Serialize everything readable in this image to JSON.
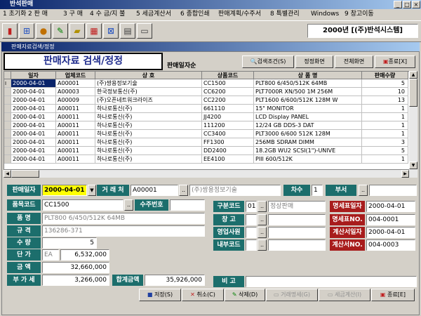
{
  "window": {
    "title": "반석판매"
  },
  "menu": [
    "1 초기화",
    "2 판 매",
    "3 구 매",
    "4 수 금/지 불",
    "5 세금계산서",
    "6 종합인쇄",
    "판매계획/수주서",
    "8 특별관리",
    "Windows",
    "9 창고이동"
  ],
  "company_label": "2000년 [(주)반석시스템]",
  "child_window": {
    "title": "판매자료검색/정정"
  },
  "header": {
    "title": "판매자료 검색/정정",
    "subtitle": "판매일자순"
  },
  "buttons": {
    "search": "검색조건(S)",
    "single": "정정화면",
    "full": "전체화면",
    "close_top": "종료[X]"
  },
  "grid": {
    "columns": [
      "일자",
      "업체코드",
      "상 호",
      "상품코드",
      "상 품 명",
      "판매수량"
    ],
    "rows": [
      [
        "2000-04-01",
        "A00001",
        "(주)쌍용정보기술",
        "CC1500",
        "PLT800 6/450/512K 64MB",
        "5"
      ],
      [
        "2000-04-01",
        "A00003",
        "한국정보통신(주)",
        "CC6200",
        "PLT7000R XN/500 1M 256M",
        "10"
      ],
      [
        "2000-04-01",
        "A00009",
        "(주)오픈네트워크라이즈",
        "CC2200",
        "PLT1600 6/600/512K 128M W",
        "13"
      ],
      [
        "2000-04-01",
        "A00011",
        "하나로통신(주)",
        "661110",
        "15\" MONITOR",
        "1"
      ],
      [
        "2000-04-01",
        "A00011",
        "하나로통신(주)",
        "JJ4200",
        "LCD Display PANEL",
        "1"
      ],
      [
        "2000-04-01",
        "A00011",
        "하나로통신(주)",
        "111200",
        "12/24 GB DDS-3 DAT",
        "1"
      ],
      [
        "2000-04-01",
        "A00011",
        "하나로통신(주)",
        "CC3400",
        "PLT3000 6/600 512K 128M",
        "1"
      ],
      [
        "2000-04-01",
        "A00011",
        "하나로통신(주)",
        "FF1300",
        "256MB SDRAM DIMM",
        "3"
      ],
      [
        "2000-04-01",
        "A00011",
        "하나로통신(주)",
        "DD2400",
        "18.2GB WU2 SCSI(1\")-UNIVE",
        "5"
      ],
      [
        "2000-04-01",
        "A00011",
        "하나로통신(주)",
        "EE4100",
        "PIII 600/512K",
        "1"
      ]
    ]
  },
  "form": {
    "sale_date_label": "판매일자",
    "sale_date": "2000-04-01",
    "customer_label": "거 래 처",
    "customer_code": "A00001",
    "customer_name": "(주)쌍용정보기술",
    "seq_label": "차수",
    "seq": "1",
    "dept_label": "부서",
    "item_code_label": "품목코드",
    "item_code": "CC1500",
    "order_label": "수주번호",
    "item_name_label": "품 명",
    "item_name": "PLT800 6/450/512K 64MB",
    "spec_label": "규 격",
    "spec": "136286-371",
    "qty_label": "수 량",
    "qty": "5",
    "price_label": "단 가",
    "unit": "EA",
    "price": "6,532,000",
    "amount_label": "금 액",
    "amount": "32,660,000",
    "vat_label": "부 가 세",
    "vat": "3,266,000",
    "total_label": "합계금액",
    "total": "35,926,000",
    "type_label": "구분코드",
    "type_code": "01",
    "type_name": "정상판매",
    "warehouse_label": "창 고",
    "sales_rep_label": "영업사원",
    "internal_label": "내부코드",
    "stmt_date_label": "명세표일자",
    "stmt_date": "2000-04-01",
    "stmt_no_label": "명세표NO.",
    "stmt_no": "004-0001",
    "tax_date_label": "계산서일자",
    "tax_date": "2000-04-01",
    "tax_no_label": "계산서NO.",
    "tax_no": "004-0003",
    "memo_label": "비 고"
  },
  "actions": {
    "save": "저장(S)",
    "cancel": "취소(C)",
    "delete": "삭제(D)",
    "trade_stmt": "거래명세(G)",
    "tax_inv": "세금계산(I)",
    "close": "종료[E]"
  }
}
